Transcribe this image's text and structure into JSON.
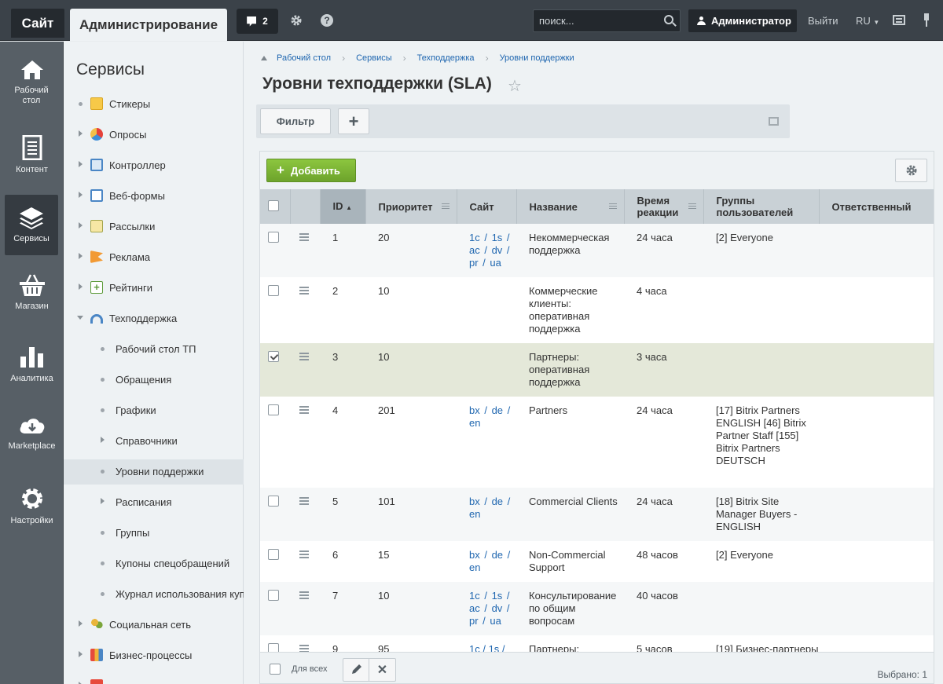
{
  "topbar": {
    "site_label": "Сайт",
    "admin_label": "Администрирование",
    "notifications_count": "2",
    "search_placeholder": "поиск...",
    "user_name": "Администратор",
    "logout_label": "Выйти",
    "language": "RU"
  },
  "left_menu": [
    {
      "label": "Рабочий стол",
      "icon": "home-icon"
    },
    {
      "label": "Контент",
      "icon": "document-icon"
    },
    {
      "label": "Сервисы",
      "icon": "layers-icon",
      "active": true
    },
    {
      "label": "Магазин",
      "icon": "basket-icon"
    },
    {
      "label": "Аналитика",
      "icon": "bar-chart-icon"
    },
    {
      "label": "Marketplace",
      "icon": "cloud-download-icon"
    },
    {
      "label": "Настройки",
      "icon": "gear-icon"
    }
  ],
  "submenu": {
    "title": "Сервисы",
    "items": [
      {
        "label": "Стикеры"
      },
      {
        "label": "Опросы"
      },
      {
        "label": "Контроллер"
      },
      {
        "label": "Веб-формы"
      },
      {
        "label": "Рассылки"
      },
      {
        "label": "Реклама"
      },
      {
        "label": "Рейтинги"
      },
      {
        "label": "Техподдержка"
      },
      {
        "label": "Рабочий стол ТП"
      },
      {
        "label": "Обращения"
      },
      {
        "label": "Графики"
      },
      {
        "label": "Справочники"
      },
      {
        "label": "Уровни поддержки"
      },
      {
        "label": "Расписания"
      },
      {
        "label": "Группы"
      },
      {
        "label": "Купоны спецобращений"
      },
      {
        "label": "Журнал использования купонов"
      },
      {
        "label": "Социальная сеть"
      },
      {
        "label": "Бизнес-процессы"
      }
    ]
  },
  "breadcrumb": [
    "Рабочий стол",
    "Сервисы",
    "Техподдержка",
    "Уровни поддержки"
  ],
  "page": {
    "title": "Уровни техподдержки (SLA)",
    "filter_label": "Фильтр",
    "add_label": "Добавить"
  },
  "grid": {
    "columns": [
      "ID",
      "Приоритет",
      "Сайт",
      "Название",
      "Время реакции",
      "Группы пользователей",
      "Ответственный"
    ],
    "footer_for_all": "Для всех",
    "selected_text": "Выбрано: 1",
    "rows": [
      {
        "id": "1",
        "priority": "20",
        "site": "1c / 1s / ac / dv / pr / ua",
        "name": "Некоммерческая поддержка",
        "time": "24 часа",
        "groups": "[2] Everyone",
        "checked": false
      },
      {
        "id": "2",
        "priority": "10",
        "site": "",
        "name": "Коммерческие клиенты: оперативная поддержка",
        "time": "4 часа",
        "groups": "",
        "checked": false
      },
      {
        "id": "3",
        "priority": "10",
        "site": "",
        "name": "Партнеры: оперативная поддержка",
        "time": "3 часа",
        "groups": "",
        "checked": true
      },
      {
        "id": "4",
        "priority": "201",
        "site": "bx / de / en",
        "name": "Partners",
        "time": "24 часа",
        "groups": "[17] Bitrix Partners ENGLISH [46] Bitrix Partner Staff [155] Bitrix Partners DEUTSCH",
        "checked": false
      },
      {
        "id": "5",
        "priority": "101",
        "site": "bx / de / en",
        "name": "Commercial Clients",
        "time": "24 часа",
        "groups": "[18] Bitrix Site Manager Buyers - ENGLISH",
        "checked": false
      },
      {
        "id": "6",
        "priority": "15",
        "site": "bx / de / en",
        "name": "Non-Commercial Support",
        "time": "48 часов",
        "groups": "[2] Everyone",
        "checked": false
      },
      {
        "id": "7",
        "priority": "10",
        "site": "1c / 1s / ac / dv / pr / ua",
        "name": "Консультирование по общим вопросам",
        "time": "40 часов",
        "groups": "",
        "checked": false
      },
      {
        "id": "9",
        "priority": "95",
        "site": "1c / 1s /",
        "name": "Партнеры:",
        "time": "5 часов",
        "groups": "[19] Бизнес-партнеры",
        "checked": false
      }
    ]
  }
}
